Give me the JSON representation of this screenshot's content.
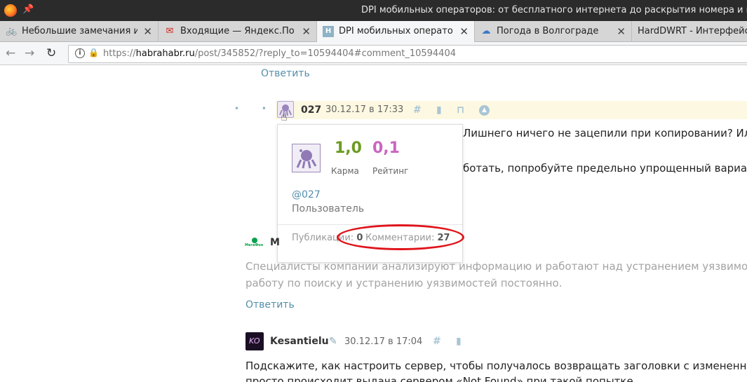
{
  "window": {
    "title": "DPI мобильных операторов: от бесплатного интернета до раскрытия номера и м"
  },
  "tabs": [
    {
      "label": "Небольшие замечания и",
      "icon": "bicycle-icon",
      "active": false
    },
    {
      "label": "Входящие — Яндекс.По",
      "icon": "mail-icon",
      "active": false
    },
    {
      "label": "DPI мобильных операто",
      "icon": "habr-icon",
      "active": true
    },
    {
      "label": "Погода в Волгограде",
      "icon": "weather-icon",
      "active": false
    },
    {
      "label": "HardDWRT - Интерфейс",
      "icon": "",
      "active": false
    }
  ],
  "nav": {
    "url_prefix": "https://",
    "url_domain": "habrahabr.ru",
    "url_path": "/post/345852/?reply_to=10594404#comment_10594404"
  },
  "page": {
    "reply_top": "Ответить",
    "comment1": {
      "author": "027",
      "date": "30.12.17 в 17:33",
      "line1": "Лишнего ничего не зацепили при копировании? Или, н",
      "line2": "ботать, попробуйте предельно упрощенный вариант."
    },
    "popup": {
      "karma_value": "1,0",
      "rating_value": "0,1",
      "karma_label": "Карма",
      "rating_label": "Рейтинг",
      "nick": "@027",
      "role": "Пользователь",
      "publications_label": "Публикации:",
      "publications_value": "0",
      "comments_label": "Комментарии:",
      "comments_value": "27",
      "highlight_color": "#e0141b"
    },
    "comment2": {
      "author_initial": "М",
      "logo_text": "МегаФон",
      "line1": "Специалисты компании анализируют информацию и работают над устранением уязвимости. Мы",
      "line2": "работу по поиску и устранению уязвимостей постоянно.",
      "reply": "Ответить"
    },
    "comment3": {
      "author": "Kesantielu",
      "date": "30.12.17 в 17:04",
      "line1": "Подскажите, как настроить сервер, чтобы получалось возвращать заголовки с измененным хост",
      "line2": "просто происходит выдача сервером «Not Found» при такой попытке"
    }
  }
}
